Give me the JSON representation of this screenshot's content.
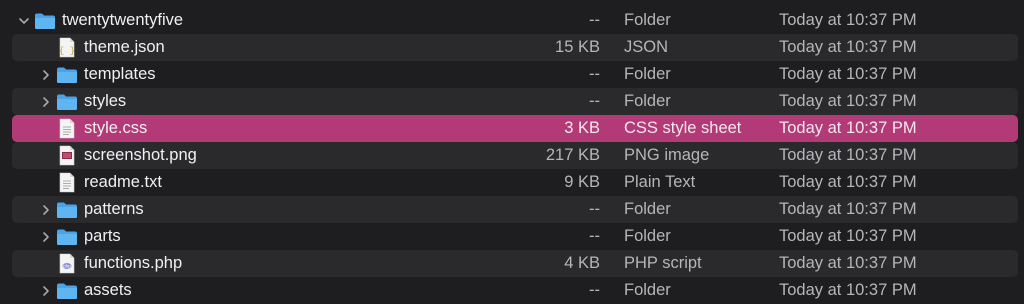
{
  "colors": {
    "background": "#1e1e20",
    "alt_row": "#2a2a2d",
    "selected_row": "#b23a76",
    "folder_blue": "#4aa3e8"
  },
  "rows": [
    {
      "name": "twentytwentyfive",
      "size": "--",
      "kind": "Folder",
      "date": "Today at 10:37 PM",
      "icon": "folder-icon",
      "depth": 0,
      "disclosure": "expanded"
    },
    {
      "name": "theme.json",
      "size": "15 KB",
      "kind": "JSON",
      "date": "Today at 10:37 PM",
      "icon": "json-file-icon",
      "depth": 1,
      "disclosure": "none"
    },
    {
      "name": "templates",
      "size": "--",
      "kind": "Folder",
      "date": "Today at 10:37 PM",
      "icon": "folder-icon",
      "depth": 1,
      "disclosure": "collapsed"
    },
    {
      "name": "styles",
      "size": "--",
      "kind": "Folder",
      "date": "Today at 10:37 PM",
      "icon": "folder-icon",
      "depth": 1,
      "disclosure": "collapsed"
    },
    {
      "name": "style.css",
      "size": "3 KB",
      "kind": "CSS style sheet",
      "date": "Today at 10:37 PM",
      "icon": "text-file-icon",
      "depth": 1,
      "disclosure": "none",
      "selected": true
    },
    {
      "name": "screenshot.png",
      "size": "217 KB",
      "kind": "PNG image",
      "date": "Today at 10:37 PM",
      "icon": "image-file-icon",
      "depth": 1,
      "disclosure": "none"
    },
    {
      "name": "readme.txt",
      "size": "9 KB",
      "kind": "Plain Text",
      "date": "Today at 10:37 PM",
      "icon": "text-file-icon",
      "depth": 1,
      "disclosure": "none"
    },
    {
      "name": "patterns",
      "size": "--",
      "kind": "Folder",
      "date": "Today at 10:37 PM",
      "icon": "folder-icon",
      "depth": 1,
      "disclosure": "collapsed"
    },
    {
      "name": "parts",
      "size": "--",
      "kind": "Folder",
      "date": "Today at 10:37 PM",
      "icon": "folder-icon",
      "depth": 1,
      "disclosure": "collapsed"
    },
    {
      "name": "functions.php",
      "size": "4 KB",
      "kind": "PHP script",
      "date": "Today at 10:37 PM",
      "icon": "php-file-icon",
      "depth": 1,
      "disclosure": "none"
    },
    {
      "name": "assets",
      "size": "--",
      "kind": "Folder",
      "date": "Today at 10:37 PM",
      "icon": "folder-icon",
      "depth": 1,
      "disclosure": "collapsed"
    }
  ]
}
